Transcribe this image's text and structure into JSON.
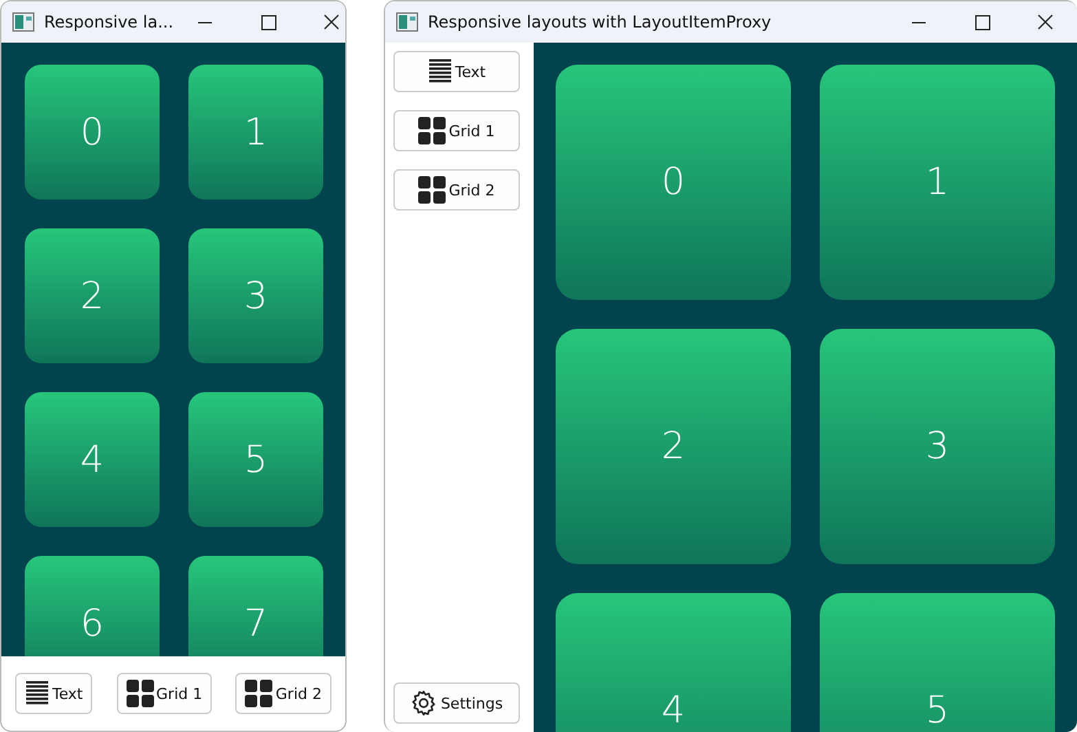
{
  "windows": [
    {
      "title": "Responsive la...",
      "kind": "narrow",
      "tiles": [
        "0",
        "1",
        "2",
        "3",
        "4",
        "5",
        "6",
        "7"
      ],
      "buttons": [
        {
          "kind": "text",
          "label": "Text"
        },
        {
          "kind": "grid",
          "label": "Grid 1"
        },
        {
          "kind": "grid",
          "label": "Grid 2"
        }
      ]
    },
    {
      "title": "Responsive layouts with LayoutItemProxy",
      "kind": "wide",
      "tiles": [
        "0",
        "1",
        "2",
        "3",
        "4",
        "5"
      ],
      "buttons": [
        {
          "kind": "text",
          "label": "Text"
        },
        {
          "kind": "grid",
          "label": "Grid 1"
        },
        {
          "kind": "grid",
          "label": "Grid 2"
        }
      ],
      "footer_buttons": [
        {
          "kind": "settings",
          "label": "Settings"
        }
      ]
    }
  ]
}
